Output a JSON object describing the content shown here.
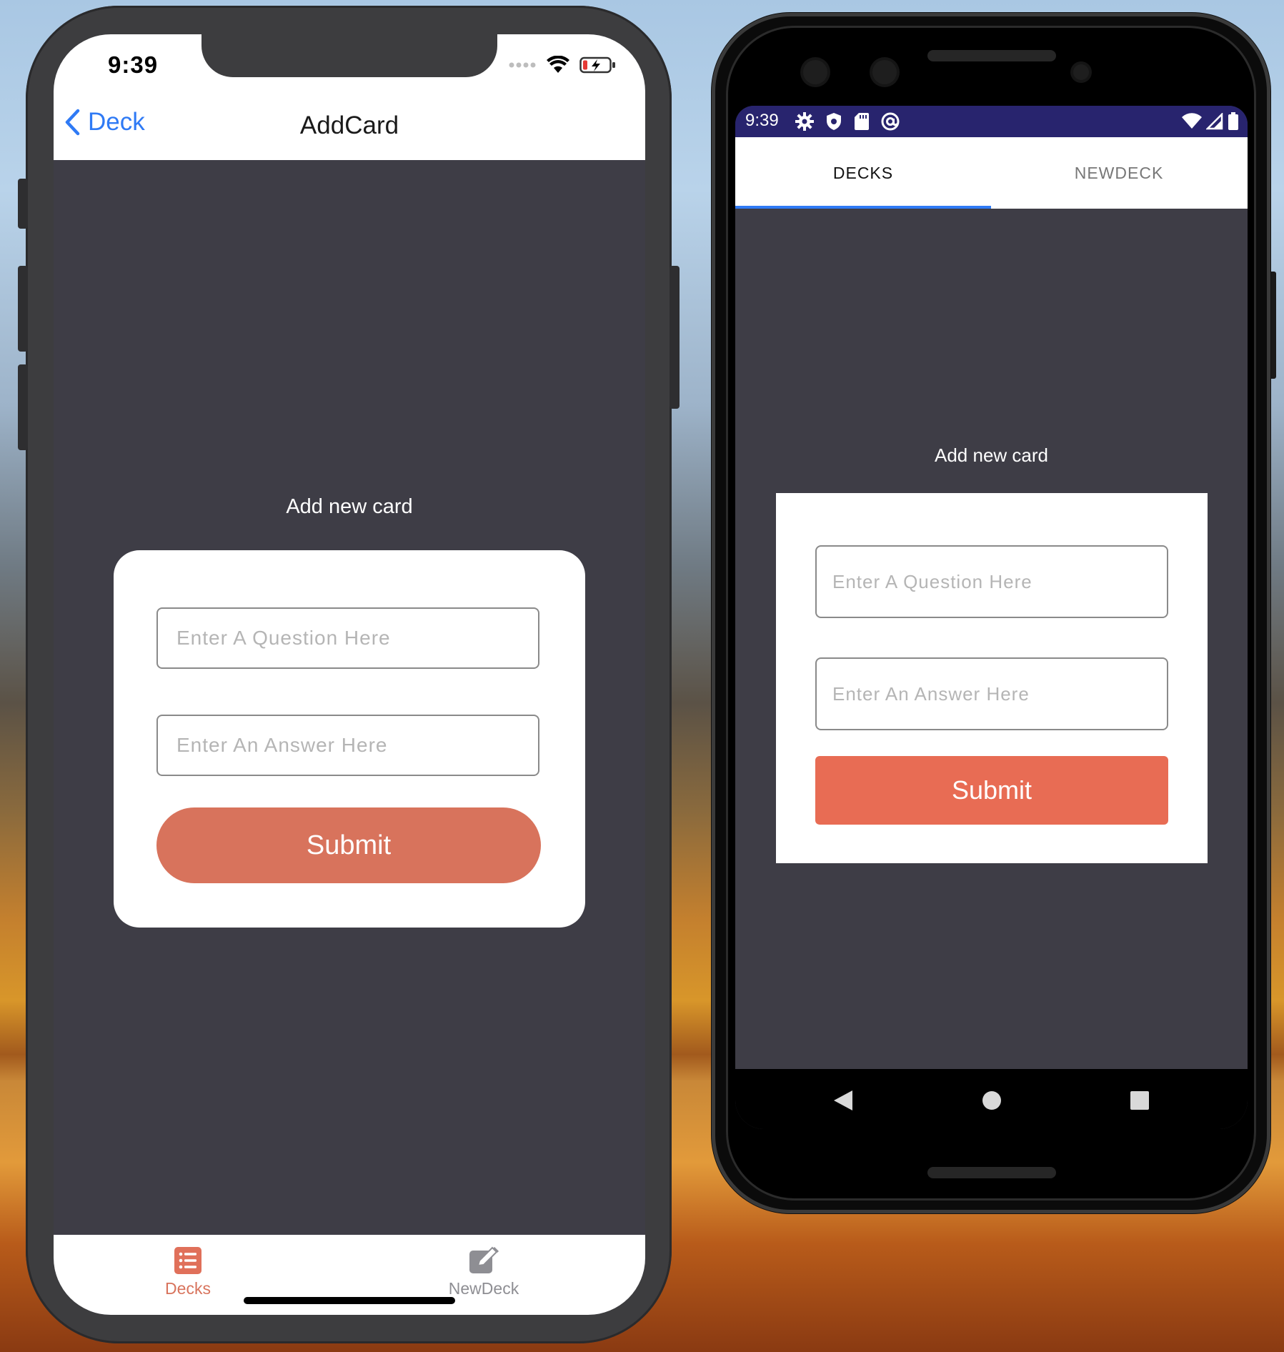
{
  "ios": {
    "status_time": "9:39",
    "back_label": "Deck",
    "nav_title": "AddCard",
    "add_label": "Add new card",
    "question_placeholder": "Enter A Question  Here",
    "answer_placeholder": "Enter An Answer  Here",
    "submit_label": "Submit",
    "tabs": [
      {
        "label": "Decks",
        "icon": "list-icon",
        "active": true
      },
      {
        "label": "NewDeck",
        "icon": "edit-icon",
        "active": false
      }
    ],
    "colors": {
      "accent": "#d8735c",
      "link": "#2f7af5",
      "inactive_tab": "#8e8e93"
    }
  },
  "android": {
    "status_time": "9:39",
    "status_icons": [
      "gear-icon",
      "shield-icon",
      "sd-card-icon",
      "at-icon"
    ],
    "status_right_icons": [
      "wifi-icon",
      "signal-icon",
      "battery-icon"
    ],
    "tabs": [
      {
        "label": "DECKS",
        "active": true
      },
      {
        "label": "NEWDECK",
        "active": false
      }
    ],
    "add_label": "Add new card",
    "question_placeholder": "Enter A Question  Here",
    "answer_placeholder": "Enter An Answer  Here",
    "submit_label": "Submit",
    "nav_buttons": [
      "back-icon",
      "home-icon",
      "recents-icon"
    ],
    "colors": {
      "accent": "#e86c54",
      "statusbar": "#28246e",
      "indicator": "#2f7af5"
    }
  }
}
